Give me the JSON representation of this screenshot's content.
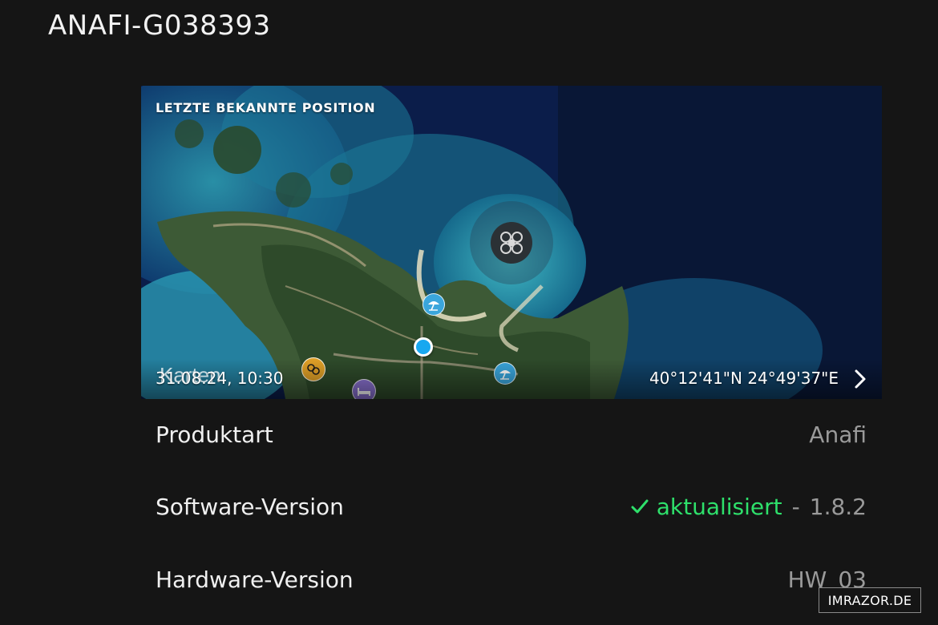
{
  "header": {
    "device_name": "ANAFI-G038393"
  },
  "map": {
    "heading": "LETZTE BEKANNTE POSITION",
    "maps_brand": "Karten",
    "timestamp": "31.08.24, 10:30",
    "coordinates": "40°12'41\"N 24°49'37\"E",
    "icons": {
      "drone": "drone-icon",
      "chevron": "chevron-right-icon",
      "beach_poi": "beach-umbrella-icon",
      "leisure_poi": "leisure-icon",
      "hotel_poi": "bed-icon"
    }
  },
  "details": {
    "product_type": {
      "label": "Produktart",
      "value": "Anafi"
    },
    "software_version": {
      "label": "Software-Version",
      "status": "aktualisiert",
      "separator": "-",
      "value": "1.8.2"
    },
    "hardware_version": {
      "label": "Hardware-Version",
      "value": "HW_03"
    }
  },
  "watermark": "IMRAZOR.DE",
  "colors": {
    "background": "#151515",
    "status_ok": "#2ee06b",
    "value_gray": "#9a9a9a",
    "location_blue": "#18a8f0"
  }
}
